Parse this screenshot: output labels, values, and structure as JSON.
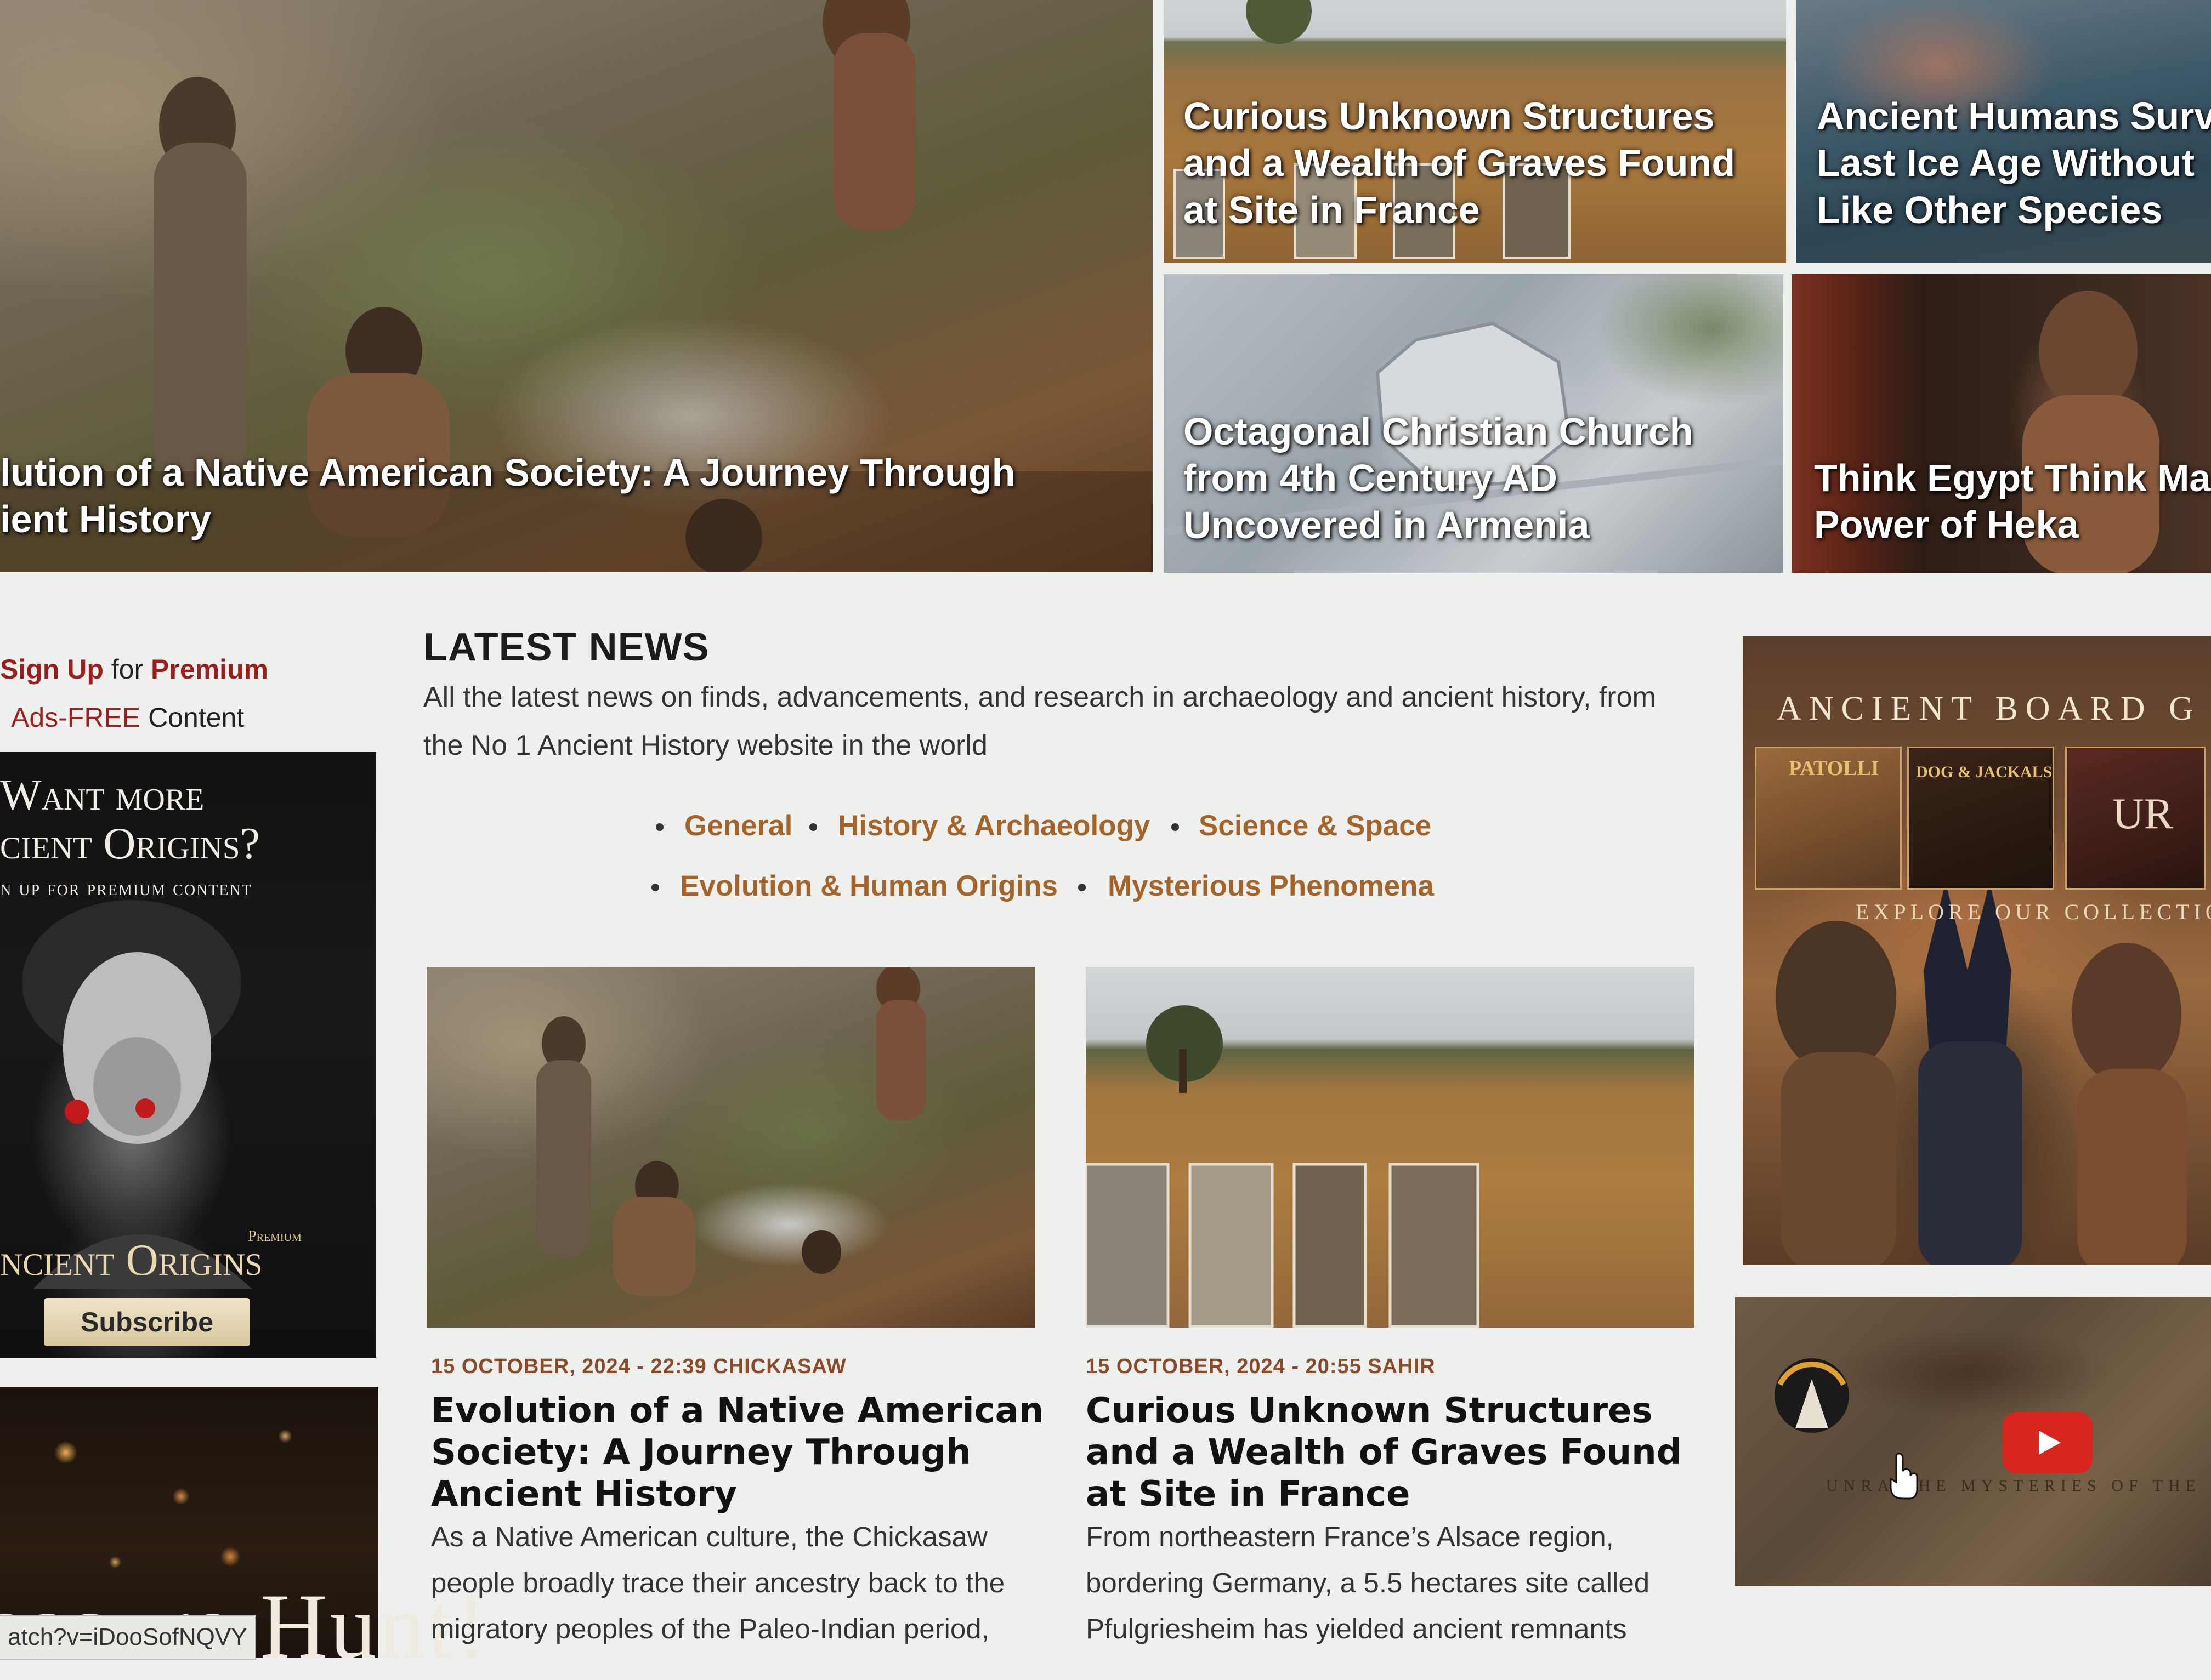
{
  "featured": {
    "main_title": "lution of a Native American Society: A Journey Through\nient History",
    "france_title": "Curious Unknown Structures\nand a Wealth of Graves Found\nat Site in France",
    "ice_title": "Ancient Humans Surv\nLast Ice Age Without\nLike Other Species",
    "church_title": "Octagonal Christian Church\nfrom 4th Century AD\nUncovered in Armenia",
    "egypt_title": "Think Egypt Think Ma\nPower of Heka"
  },
  "sidebar_left": {
    "signup_link": "Sign Up",
    "signup_for": "for",
    "premium": "Premium",
    "ads_free": "Ads-FREE",
    "content": "Content",
    "promo_line1": "Want more",
    "promo_line2": "cient Origins?",
    "promo_line3": "n up for premium content",
    "promo_badge": "Premium",
    "promo_brand": "ncient Origins",
    "subscribe_label": "Subscribe",
    "treasure_text": "easure Hunt!",
    "status_url": "atch?v=iDooSofNQVY"
  },
  "latest_news": {
    "heading": "LATEST NEWS",
    "description": "All the latest news on finds, advancements, and research in archaeology and ancient history, from the No 1 Ancient History website in the world",
    "categories": [
      "General",
      "History & Archaeology",
      "Science & Space",
      "Evolution & Human Origins",
      "Mysterious Phenomena"
    ]
  },
  "articles": [
    {
      "meta": "15 OCTOBER, 2024 - 22:39 CHICKASAW",
      "title": "Evolution of a Native American Society: A Journey Through Ancient History",
      "excerpt": "As a Native American culture, the Chickasaw people broadly trace their ancestry back to the migratory peoples of the Paleo-Indian period,"
    },
    {
      "meta": "15 OCTOBER, 2024 - 20:55 SAHIR",
      "title": "Curious Unknown Structures and a Wealth of Graves Found at Site in France",
      "excerpt": "From northeastern France’s Alsace region, bordering Germany, a 5.5 hectares site called Pfulgriesheim has yielded ancient remnants"
    }
  ],
  "sidebar_right": {
    "board_title": "ANCIENT BOARD G",
    "board_subtitle": "EXPLORE OUR COLLECTIO",
    "game1": "PATOLLI",
    "game2": "DOG & JACKALS",
    "game3": "UR",
    "video_caption": "UNRA        THE MYSTERIES OF THE"
  },
  "colors": {
    "link_brown": "#a4642a",
    "premium_red": "#9a1f1f",
    "meta_brown": "#8a4b2a",
    "youtube_red": "#d8261e"
  }
}
